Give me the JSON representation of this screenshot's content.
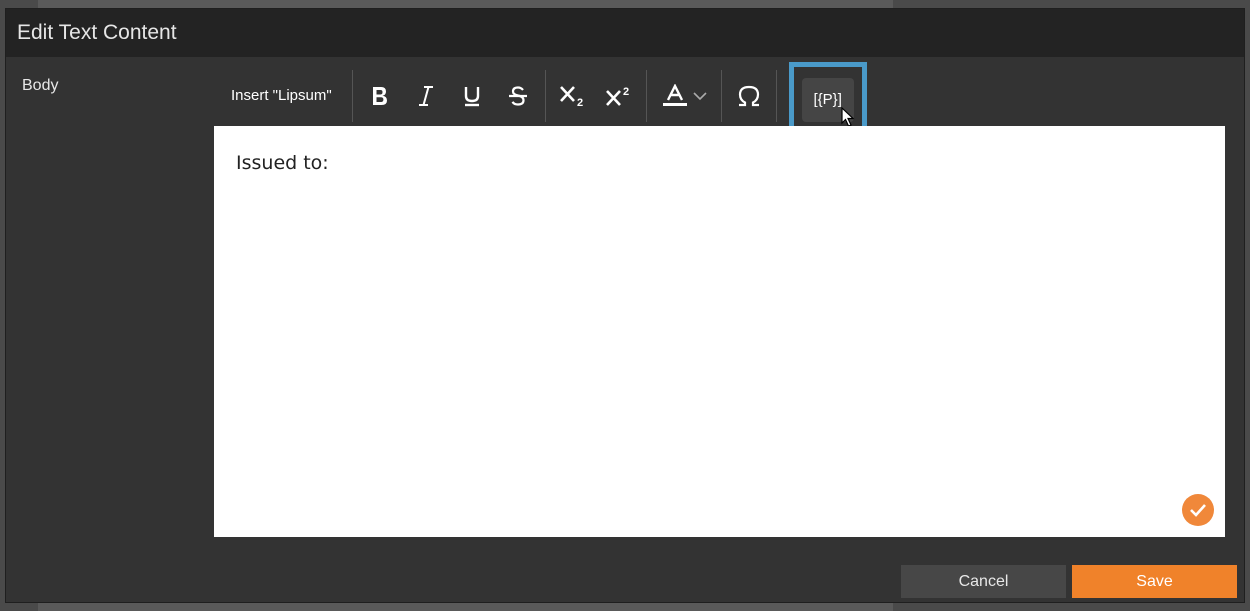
{
  "dialog": {
    "title": "Edit Text Content"
  },
  "field": {
    "label": "Body"
  },
  "toolbar": {
    "insert_lipsum_label": "Insert \"Lipsum\"",
    "placeholder_label": "[{P}]",
    "icons": [
      "bold-icon",
      "italic-icon",
      "underline-icon",
      "strikethrough-icon",
      "subscript-icon",
      "superscript-icon",
      "text-color-icon",
      "chevron-down-icon",
      "omega-icon"
    ]
  },
  "editor": {
    "content": "Issued to:"
  },
  "footer": {
    "cancel_label": "Cancel",
    "save_label": "Save"
  },
  "colors": {
    "accent": "#f0822a",
    "highlight": "#4a9ac9",
    "dialog_bg": "#333333",
    "titlebar_bg": "#232323"
  }
}
